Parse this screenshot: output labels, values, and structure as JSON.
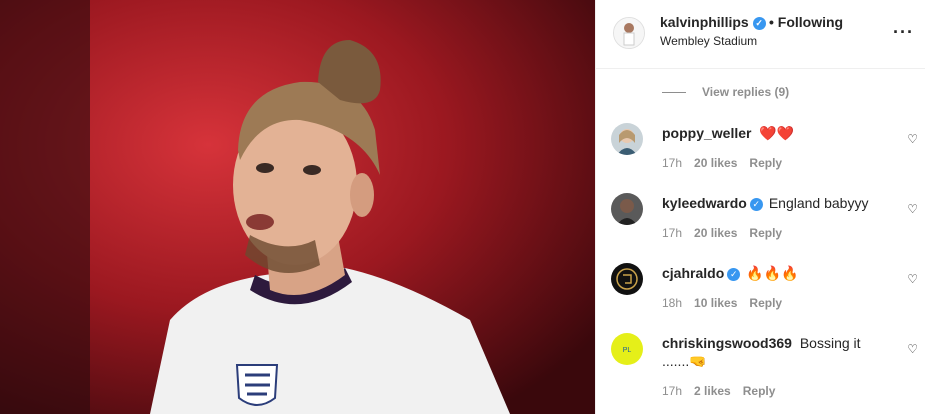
{
  "post": {
    "username": "kalvinphillips",
    "follow_label": "• Following",
    "location": "Wembley Stadium",
    "more_label": "···"
  },
  "view_replies": "View replies (9)",
  "comments": [
    {
      "user": "poppy_weller",
      "text": "❤️❤️",
      "time": "17h",
      "likes": "20 likes",
      "reply": "Reply",
      "verified": false
    },
    {
      "user": "kyleedwardo",
      "text": "England babyyy",
      "time": "17h",
      "likes": "20 likes",
      "reply": "Reply",
      "verified": true
    },
    {
      "user": "cjahraldo",
      "text": "🔥🔥🔥",
      "time": "18h",
      "likes": "10 likes",
      "reply": "Reply",
      "verified": true
    },
    {
      "user": "chriskingswood369",
      "text": "Bossing it .......🤜",
      "time": "17h",
      "likes": "2 likes",
      "reply": "Reply",
      "verified": false
    }
  ],
  "icons": {
    "heart": "heart-icon",
    "verified": "verified-badge-icon",
    "more": "more-options-icon"
  }
}
